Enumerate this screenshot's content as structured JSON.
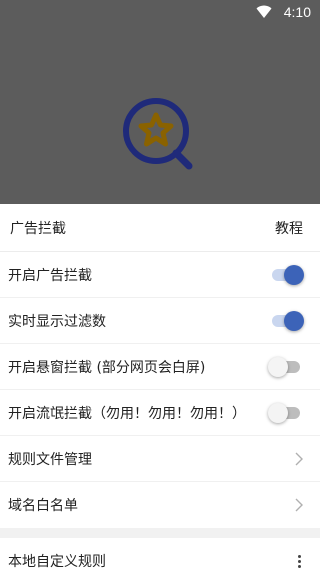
{
  "status_bar": {
    "time": "4:10",
    "wifi_icon": "wifi-icon"
  },
  "hero": {
    "logo_icon": "star-search-icon"
  },
  "sheet": {
    "title": "广告拦截",
    "action_label": "教程",
    "items": [
      {
        "label": "开启广告拦截",
        "control": "toggle",
        "on": true
      },
      {
        "label": "实时显示过滤数",
        "control": "toggle",
        "on": true
      },
      {
        "label": "开启悬窗拦截 (部分网页会白屏)",
        "control": "toggle",
        "on": false
      },
      {
        "label": "开启流氓拦截（勿用！勿用！勿用！）",
        "control": "toggle",
        "on": false
      },
      {
        "label": "规则文件管理",
        "control": "chevron"
      },
      {
        "label": "域名白名单",
        "control": "chevron"
      }
    ],
    "section2_item": {
      "label": "本地自定义规则",
      "control": "more-icon"
    }
  },
  "colors": {
    "accent": "#3c63b8",
    "dim": "#5c5c5c",
    "logo_ring": "#1f2a7a",
    "logo_star": "#8a6200"
  }
}
